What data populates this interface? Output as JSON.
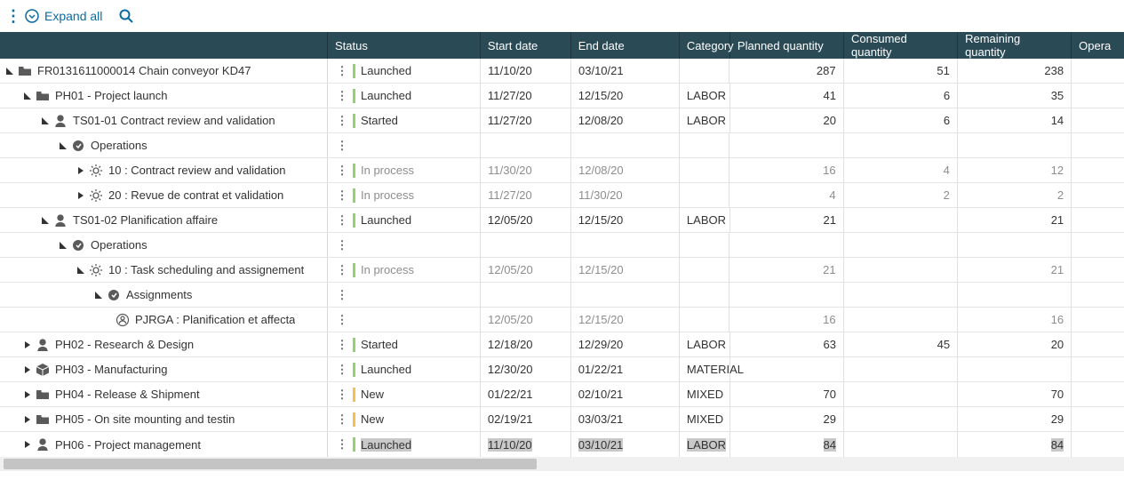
{
  "toolbar": {
    "expand_label": "Expand all"
  },
  "columns": [
    "Status",
    "Start date",
    "End date",
    "Category",
    "Planned quantity",
    "Consumed quantity",
    "Remaining quantity",
    "Opera"
  ],
  "rows": [
    {
      "indent": 0,
      "chev": "down",
      "icon": "folder",
      "label": "FR0131611000014 Chain conveyor KD47",
      "status": "Launched",
      "bar": "green",
      "start": "11/10/20",
      "end": "03/10/21",
      "cat": "",
      "plan": "287",
      "cons": "51",
      "rem": "238",
      "dim": false
    },
    {
      "indent": 1,
      "chev": "down",
      "icon": "folder",
      "label": "PH01 - Project launch",
      "status": "Launched",
      "bar": "green",
      "start": "11/27/20",
      "end": "12/15/20",
      "cat": "LABOR",
      "plan": "41",
      "cons": "6",
      "rem": "35",
      "dim": false
    },
    {
      "indent": 2,
      "chev": "down",
      "icon": "person",
      "label": "TS01-01 Contract review and validation",
      "status": "Started",
      "bar": "green",
      "start": "11/27/20",
      "end": "12/08/20",
      "cat": "LABOR",
      "plan": "20",
      "cons": "6",
      "rem": "14",
      "dim": false
    },
    {
      "indent": 3,
      "chev": "down",
      "icon": "circle",
      "label": "Operations",
      "status": "",
      "bar": "",
      "start": "",
      "end": "",
      "cat": "",
      "plan": "",
      "cons": "",
      "rem": "",
      "dim": false
    },
    {
      "indent": 4,
      "chev": "right",
      "icon": "gear",
      "label": "10 : Contract review and validation",
      "status": "In process",
      "bar": "green",
      "start": "11/30/20",
      "end": "12/08/20",
      "cat": "",
      "plan": "16",
      "cons": "4",
      "rem": "12",
      "dim": true
    },
    {
      "indent": 4,
      "chev": "right",
      "icon": "gear",
      "label": "20 : Revue de contrat et validation",
      "status": "In process",
      "bar": "green",
      "start": "11/27/20",
      "end": "11/30/20",
      "cat": "",
      "plan": "4",
      "cons": "2",
      "rem": "2",
      "dim": true
    },
    {
      "indent": 2,
      "chev": "down",
      "icon": "person",
      "label": "TS01-02 Planification affaire",
      "status": "Launched",
      "bar": "green",
      "start": "12/05/20",
      "end": "12/15/20",
      "cat": "LABOR",
      "plan": "21",
      "cons": "",
      "rem": "21",
      "dim": false
    },
    {
      "indent": 3,
      "chev": "down",
      "icon": "circle",
      "label": "Operations",
      "status": "",
      "bar": "",
      "start": "",
      "end": "",
      "cat": "",
      "plan": "",
      "cons": "",
      "rem": "",
      "dim": false
    },
    {
      "indent": 4,
      "chev": "down",
      "icon": "gear",
      "label": "10 : Task scheduling and assignement",
      "status": "In process",
      "bar": "green",
      "start": "12/05/20",
      "end": "12/15/20",
      "cat": "",
      "plan": "21",
      "cons": "",
      "rem": "21",
      "dim": true
    },
    {
      "indent": 5,
      "chev": "down",
      "icon": "circle",
      "label": "Assignments",
      "status": "",
      "bar": "",
      "start": "",
      "end": "",
      "cat": "",
      "plan": "",
      "cons": "",
      "rem": "",
      "dim": false
    },
    {
      "indent": 6,
      "chev": "none",
      "icon": "assign",
      "label": "PJRGA : Planification et affecta",
      "status": "",
      "bar": "",
      "start": "12/05/20",
      "end": "12/15/20",
      "cat": "",
      "plan": "16",
      "cons": "",
      "rem": "16",
      "dim": true
    },
    {
      "indent": 1,
      "chev": "right",
      "icon": "person",
      "label": "PH02 - Research & Design",
      "status": "Started",
      "bar": "green",
      "start": "12/18/20",
      "end": "12/29/20",
      "cat": "LABOR",
      "plan": "63",
      "cons": "45",
      "rem": "20",
      "dim": false
    },
    {
      "indent": 1,
      "chev": "right",
      "icon": "box",
      "label": "PH03 - Manufacturing",
      "status": "Launched",
      "bar": "green",
      "start": "12/30/20",
      "end": "01/22/21",
      "cat": "MATERIAL",
      "plan": "",
      "cons": "",
      "rem": "",
      "dim": false
    },
    {
      "indent": 1,
      "chev": "right",
      "icon": "folder",
      "label": "PH04 - Release & Shipment",
      "status": "New",
      "bar": "amber",
      "start": "01/22/21",
      "end": "02/10/21",
      "cat": "MIXED",
      "plan": "70",
      "cons": "",
      "rem": "70",
      "dim": false
    },
    {
      "indent": 1,
      "chev": "right",
      "icon": "folder",
      "label": "PH05 - On site mounting and testin",
      "status": "New",
      "bar": "amber",
      "start": "02/19/21",
      "end": "03/03/21",
      "cat": "MIXED",
      "plan": "29",
      "cons": "",
      "rem": "29",
      "dim": false
    },
    {
      "indent": 1,
      "chev": "right",
      "icon": "person",
      "label": "PH06 - Project management",
      "status": "Launched",
      "bar": "green",
      "start": "11/10/20",
      "end": "03/10/21",
      "cat": "LABOR",
      "plan": "84",
      "cons": "",
      "rem": "84",
      "dim": false,
      "sel": true
    }
  ]
}
